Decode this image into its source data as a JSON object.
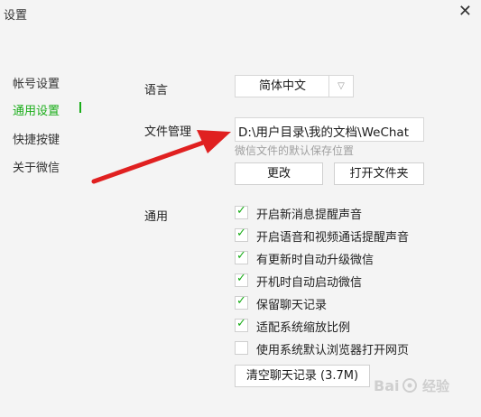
{
  "window": {
    "title": "设置",
    "close_icon": "close-icon"
  },
  "sidebar": {
    "items": [
      {
        "label": "帐号设置",
        "active": false
      },
      {
        "label": "通用设置",
        "active": true
      },
      {
        "label": "快捷按键",
        "active": false
      },
      {
        "label": "关于微信",
        "active": false
      }
    ],
    "active_color": "#1aad19"
  },
  "language": {
    "label": "语言",
    "value": "简体中文"
  },
  "file_management": {
    "label": "文件管理",
    "path": "D:\\用户目录\\我的文档\\WeChat",
    "hint": "微信文件的默认保存位置",
    "change_button": "更改",
    "open_folder_button": "打开文件夹"
  },
  "general": {
    "label": "通用",
    "options": [
      {
        "label": "开启新消息提醒声音",
        "checked": true
      },
      {
        "label": "开启语音和视频通话提醒声音",
        "checked": true
      },
      {
        "label": "有更新时自动升级微信",
        "checked": true
      },
      {
        "label": "开机时自动启动微信",
        "checked": true
      },
      {
        "label": "保留聊天记录",
        "checked": true
      },
      {
        "label": "适配系统缩放比例",
        "checked": true
      },
      {
        "label": "使用系统默认浏览器打开网页",
        "checked": false
      }
    ],
    "clear_button": "清空聊天记录 (3.7M)"
  },
  "annotation": {
    "arrow_color": "#e02020"
  },
  "watermark": {
    "text": "Bai 经验"
  }
}
